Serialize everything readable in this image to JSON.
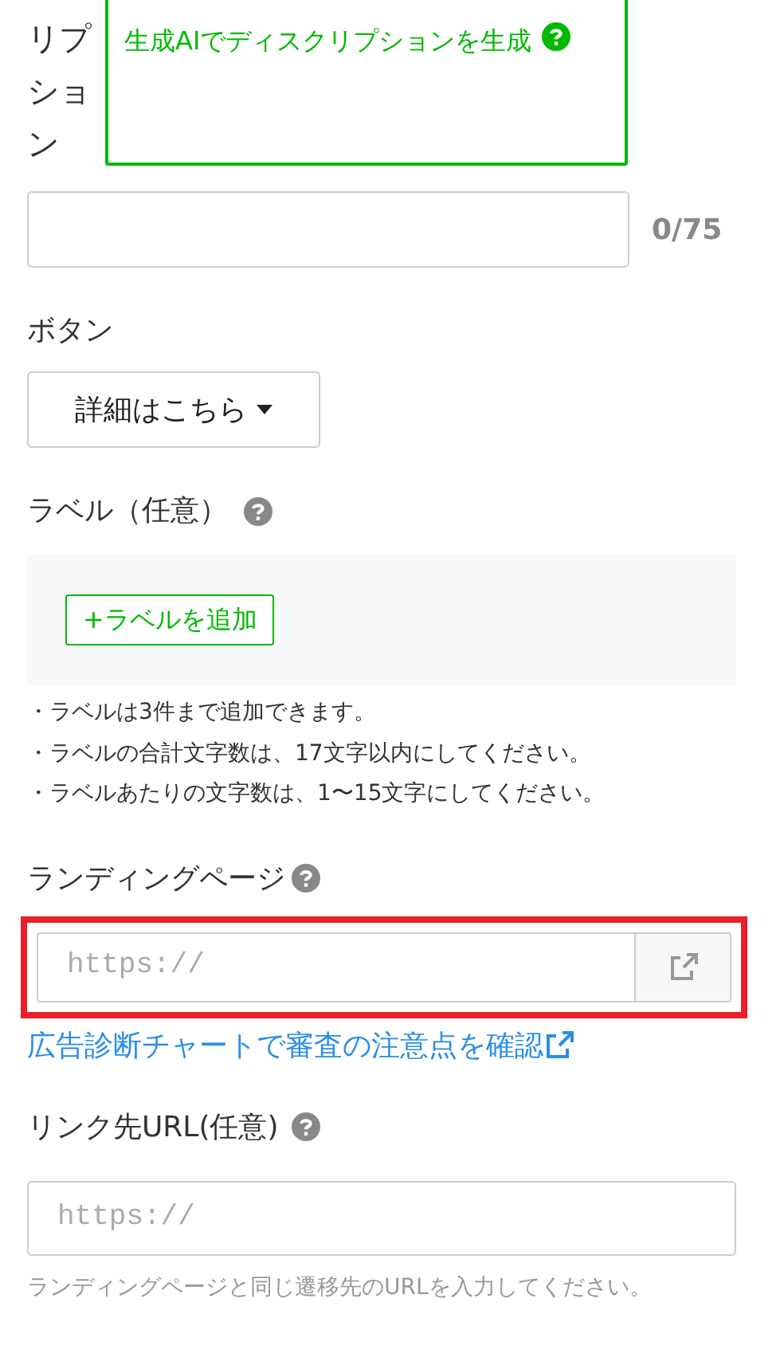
{
  "description": {
    "label": "リプション",
    "generate_link": "生成AIでディスクリプションを生成",
    "counter": "0/75"
  },
  "button_section": {
    "label": "ボタン",
    "dropdown": "詳細はこちら"
  },
  "labels_section": {
    "label": "ラベル（任意）",
    "add_button": "+ラベルを追加",
    "notes": [
      "・ラベルは3件まで追加できます。",
      "・ラベルの合計文字数は、17文字以内にしてください。",
      "・ラベルあたりの文字数は、1〜15文字にしてください。"
    ]
  },
  "landing_page": {
    "label": "ランディングページ",
    "placeholder": "https://",
    "highlighted": true,
    "link": "広告診断チャートで審査の注意点を確認"
  },
  "link_url": {
    "label": "リンク先URL(任意)",
    "placeholder": "https://",
    "help": "ランディングページと同じ遷移先のURLを入力してください。"
  }
}
